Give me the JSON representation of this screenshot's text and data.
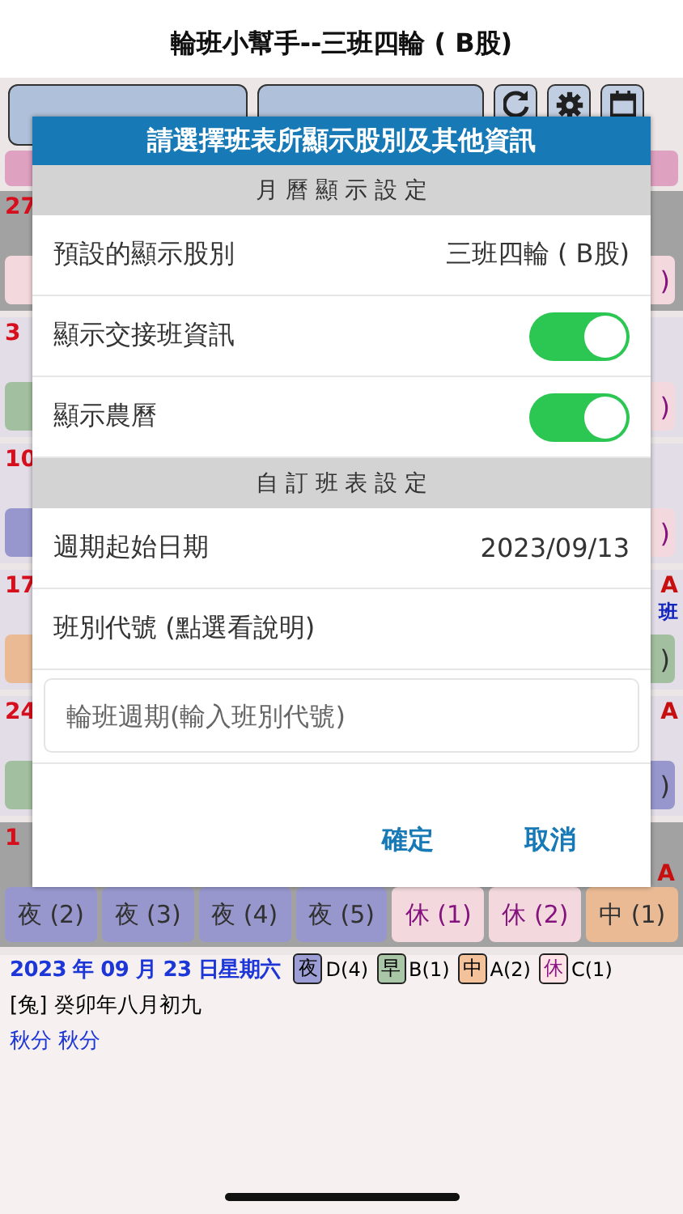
{
  "app_title": "輪班小幫手--三班四輪 ( B股)",
  "calendar": {
    "weeks": [
      {
        "day": "27",
        "left_shift": {
          "kind": "rest"
        },
        "right_shift": {
          "label": ")",
          "kind": "rest"
        },
        "selected": true
      },
      {
        "day": "3",
        "left_shift": {
          "kind": "morning"
        },
        "right_shift": {
          "label": ")",
          "kind": "rest"
        },
        "selected": false
      },
      {
        "day": "10",
        "left_shift": {
          "kind": "night"
        },
        "right_shift": {
          "label": ")",
          "kind": "rest"
        },
        "selected": false
      },
      {
        "day": "17",
        "left_shift": {
          "kind": "mid"
        },
        "right_shift": {
          "label": ")",
          "kind": "morning"
        },
        "right_notes": [
          "A",
          "班"
        ],
        "selected": false
      },
      {
        "day": "24",
        "left_shift": {
          "kind": "morning"
        },
        "right_shift": {
          "label": ")",
          "kind": "night"
        },
        "right_notes": [
          "A"
        ],
        "selected": false
      }
    ],
    "last_week": {
      "day": "1",
      "right_notes": [
        "A"
      ],
      "selected": true,
      "shifts": [
        {
          "label": "夜 (2)",
          "kind": "night"
        },
        {
          "label": "夜 (3)",
          "kind": "night"
        },
        {
          "label": "夜 (4)",
          "kind": "night"
        },
        {
          "label": "夜 (5)",
          "kind": "night"
        },
        {
          "label": "休 (1)",
          "kind": "rest"
        },
        {
          "label": "休 (2)",
          "kind": "rest"
        },
        {
          "label": "中 (1)",
          "kind": "mid"
        }
      ]
    }
  },
  "info": {
    "date": "2023 年 09 月 23 日星期六",
    "legend": [
      {
        "tag": "夜",
        "text": "D(4)",
        "kind": "night"
      },
      {
        "tag": "早",
        "text": "B(1)",
        "kind": "morning"
      },
      {
        "tag": "中",
        "text": "A(2)",
        "kind": "mid"
      },
      {
        "tag": "休",
        "text": "C(1)",
        "kind": "rest"
      }
    ],
    "lunar": "[兔] 癸卯年八月初九",
    "terms": "秋分  秋分"
  },
  "dialog": {
    "title": "請選擇班表所顯示股別及其他資訊",
    "sections": [
      {
        "title": "月 曆 顯 示 設 定",
        "rows": [
          {
            "kind": "value",
            "label": "預設的顯示股別",
            "value": "三班四輪 ( B股)"
          },
          {
            "kind": "toggle",
            "label": "顯示交接班資訊",
            "on": true
          },
          {
            "kind": "toggle",
            "label": "顯示農曆",
            "on": true
          }
        ]
      },
      {
        "title": "自 訂 班 表 設 定",
        "rows": [
          {
            "kind": "value",
            "label": "週期起始日期",
            "value": "2023/09/13"
          },
          {
            "kind": "link",
            "label": "班別代號 (點選看說明)"
          },
          {
            "kind": "input",
            "placeholder": "輪班週期(輸入班別代號)"
          }
        ]
      }
    ],
    "buttons": [
      "確定",
      "取消"
    ]
  }
}
